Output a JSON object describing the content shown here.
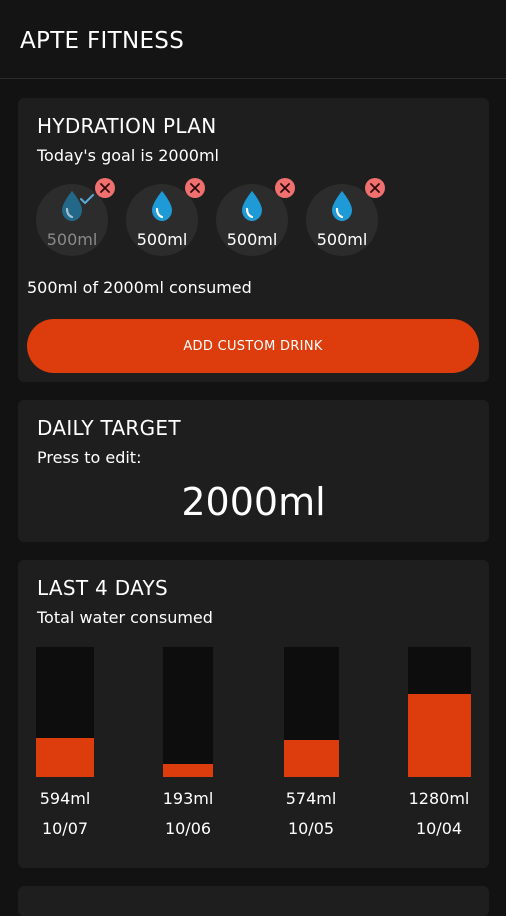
{
  "app": {
    "title": "APTE FITNESS"
  },
  "colors": {
    "background": "#121212",
    "card": "#1e1e1e",
    "accent": "#dd3d0c",
    "water": "#1e9bd7",
    "remove": "#f07070"
  },
  "hydration": {
    "title": "HYDRATION PLAN",
    "goal_text": "Today's goal is 2000ml",
    "drinks": [
      {
        "label": "500ml",
        "consumed": true,
        "icon": "water-drop-icon"
      },
      {
        "label": "500ml",
        "consumed": false,
        "icon": "water-drop-icon"
      },
      {
        "label": "500ml",
        "consumed": false,
        "icon": "water-drop-icon"
      },
      {
        "label": "500ml",
        "consumed": false,
        "icon": "water-drop-icon"
      }
    ],
    "consumed_text": "500ml of 2000ml consumed",
    "add_button_label": "ADD CUSTOM DRINK"
  },
  "daily_target": {
    "title": "DAILY TARGET",
    "hint": "Press to edit:",
    "value": "2000ml"
  },
  "history": {
    "title": "LAST 4 DAYS",
    "subtitle": "Total water consumed"
  },
  "chart_data": {
    "type": "bar",
    "categories": [
      "10/07",
      "10/06",
      "10/05",
      "10/04"
    ],
    "values": [
      594,
      193,
      574,
      1280
    ],
    "value_labels": [
      "594ml",
      "193ml",
      "574ml",
      "1280ml"
    ],
    "ylim": [
      0,
      2000
    ]
  }
}
